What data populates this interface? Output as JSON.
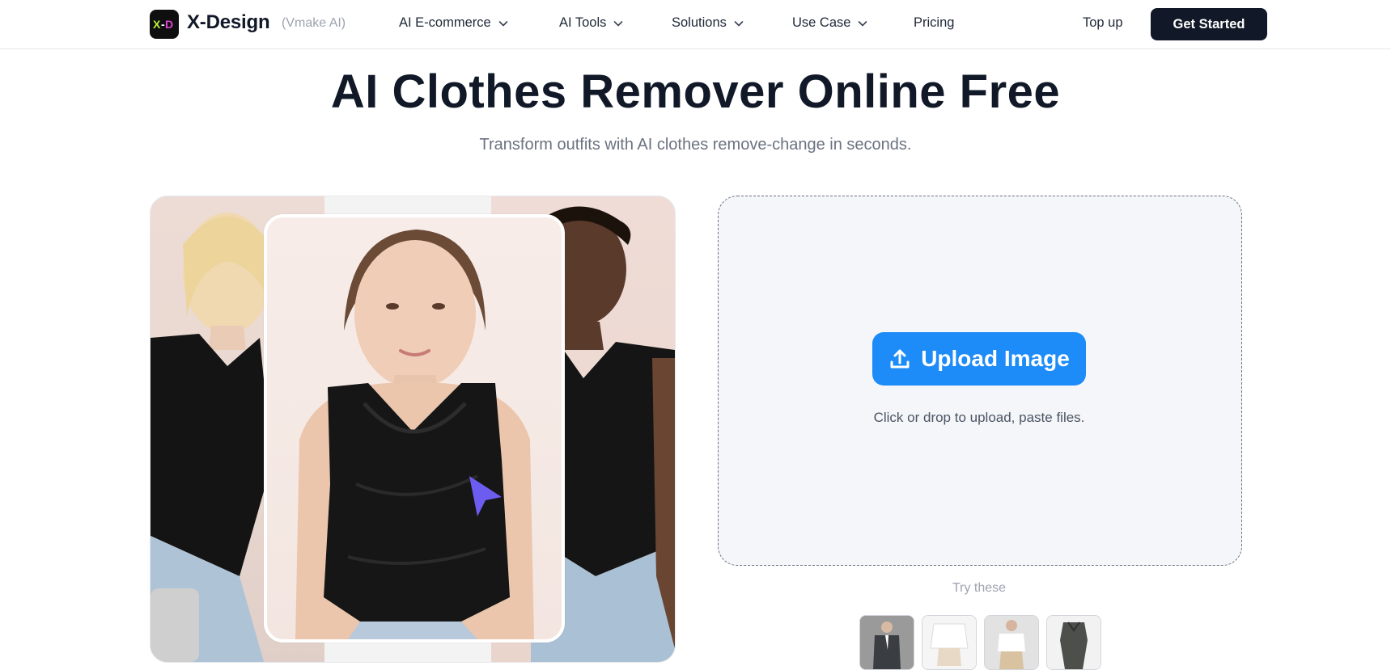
{
  "nav": {
    "brand": "X-Design",
    "brand_sub": "(Vmake AI)",
    "items": [
      {
        "label": "AI E-commerce"
      },
      {
        "label": "AI Tools"
      },
      {
        "label": "Solutions"
      },
      {
        "label": "Use Case"
      },
      {
        "label": "Pricing"
      }
    ],
    "topup": "Top up",
    "cta": "Get Started"
  },
  "hero": {
    "title": "AI Clothes Remover Online Free",
    "subtitle": "Transform outfits with AI clothes remove-change in seconds."
  },
  "upload": {
    "button_label": "Upload Image",
    "hint": "Click or drop to upload, paste files.",
    "try_label": "Try these"
  },
  "colors": {
    "accent": "#1d8bf8",
    "dark": "#111827",
    "cursor": "#6c5cf0"
  },
  "icons": {
    "logo": "x-d-logo-icon",
    "chevron": "chevron-down-icon",
    "upload": "upload-icon",
    "pointer": "cursor-pointer-icon"
  }
}
